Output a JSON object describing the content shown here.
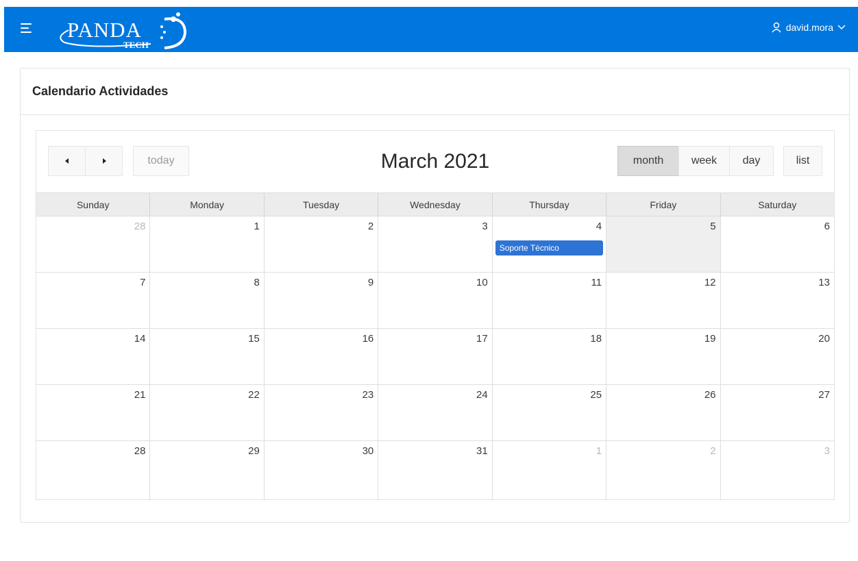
{
  "header": {
    "logo_text": "PANDA",
    "logo_sub": "TECH",
    "username": "david.mora"
  },
  "region": {
    "title": "Calendario Actividades"
  },
  "calendar": {
    "title": "March 2021",
    "today_label": "today",
    "view_month": "month",
    "view_week": "week",
    "view_day": "day",
    "view_list": "list",
    "active_view": "month",
    "weekdays": [
      "Sunday",
      "Monday",
      "Tuesday",
      "Wednesday",
      "Thursday",
      "Friday",
      "Saturday"
    ],
    "weeks": [
      [
        {
          "n": "28",
          "other": true
        },
        {
          "n": "1"
        },
        {
          "n": "2"
        },
        {
          "n": "3"
        },
        {
          "n": "4",
          "event": "Soporte Técnico"
        },
        {
          "n": "5",
          "today": true
        },
        {
          "n": "6"
        }
      ],
      [
        {
          "n": "7"
        },
        {
          "n": "8"
        },
        {
          "n": "9"
        },
        {
          "n": "10"
        },
        {
          "n": "11"
        },
        {
          "n": "12"
        },
        {
          "n": "13"
        }
      ],
      [
        {
          "n": "14"
        },
        {
          "n": "15"
        },
        {
          "n": "16"
        },
        {
          "n": "17"
        },
        {
          "n": "18"
        },
        {
          "n": "19"
        },
        {
          "n": "20"
        }
      ],
      [
        {
          "n": "21"
        },
        {
          "n": "22"
        },
        {
          "n": "23"
        },
        {
          "n": "24"
        },
        {
          "n": "25"
        },
        {
          "n": "26"
        },
        {
          "n": "27"
        }
      ],
      [
        {
          "n": "28"
        },
        {
          "n": "29"
        },
        {
          "n": "30"
        },
        {
          "n": "31"
        },
        {
          "n": "1",
          "other": true
        },
        {
          "n": "2",
          "other": true
        },
        {
          "n": "3",
          "other": true
        }
      ]
    ]
  },
  "colors": {
    "header_bg": "#0076df",
    "event_bg": "#2e74d4",
    "today_bg": "#efefef"
  }
}
